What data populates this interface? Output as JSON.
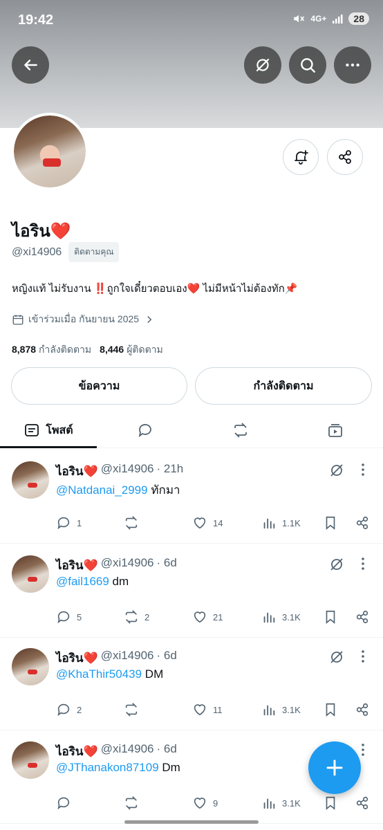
{
  "status": {
    "time": "19:42",
    "network": "4G+",
    "battery": "28"
  },
  "profile": {
    "name": "ไอริน❤️",
    "handle": "@xi14906",
    "follows_you": "ติดตามคุณ",
    "bio": "หญิงแท้ ไม่รับงาน ‼️ถูกใจเดี๋ยวตอบเอง❤️ ไม่มีหน้าไม่ต้องทัก📌",
    "joined": "เข้าร่วมเมื่อ กันยายน 2025",
    "following_count": "8,878",
    "following_label": "กำลังติดตาม",
    "followers_count": "8,446",
    "followers_label": "ผู้ติดตาม",
    "message_button": "ข้อความ",
    "following_button": "กำลังติดตาม"
  },
  "tabs": {
    "posts": "โพสต์"
  },
  "posts": [
    {
      "name": "ไอริน❤️",
      "handle": "@xi14906",
      "time": "· 21h",
      "mention": "@Natdanai_2999",
      "text": " ทักมา",
      "replies": "1",
      "reposts": "",
      "likes": "14",
      "views": "1.1K"
    },
    {
      "name": "ไอริน❤️",
      "handle": "@xi14906",
      "time": "· 6d",
      "mention": "@fail1669",
      "text": " dm",
      "replies": "5",
      "reposts": "2",
      "likes": "21",
      "views": "3.1K"
    },
    {
      "name": "ไอริน❤️",
      "handle": "@xi14906",
      "time": "· 6d",
      "mention": "@KhaThir50439",
      "text": " DM",
      "replies": "2",
      "reposts": "",
      "likes": "11",
      "views": "3.1K"
    },
    {
      "name": "ไอริน❤️",
      "handle": "@xi14906",
      "time": "· 6d",
      "mention": "@JThanakon87109",
      "text": " Dm",
      "replies": "",
      "reposts": "",
      "likes": "9",
      "views": "3.1K"
    }
  ],
  "colors": {
    "accent": "#1d9bf0",
    "text": "#0f1419",
    "muted": "#536471"
  },
  "icons": [
    "back-arrow-icon",
    "grok-icon",
    "search-icon",
    "more-icon",
    "notification-plus-icon",
    "share-icon",
    "calendar-icon",
    "chevron-right-icon",
    "reply-icon",
    "repost-icon",
    "like-icon",
    "views-icon",
    "bookmark-icon",
    "compose-plus-icon"
  ]
}
